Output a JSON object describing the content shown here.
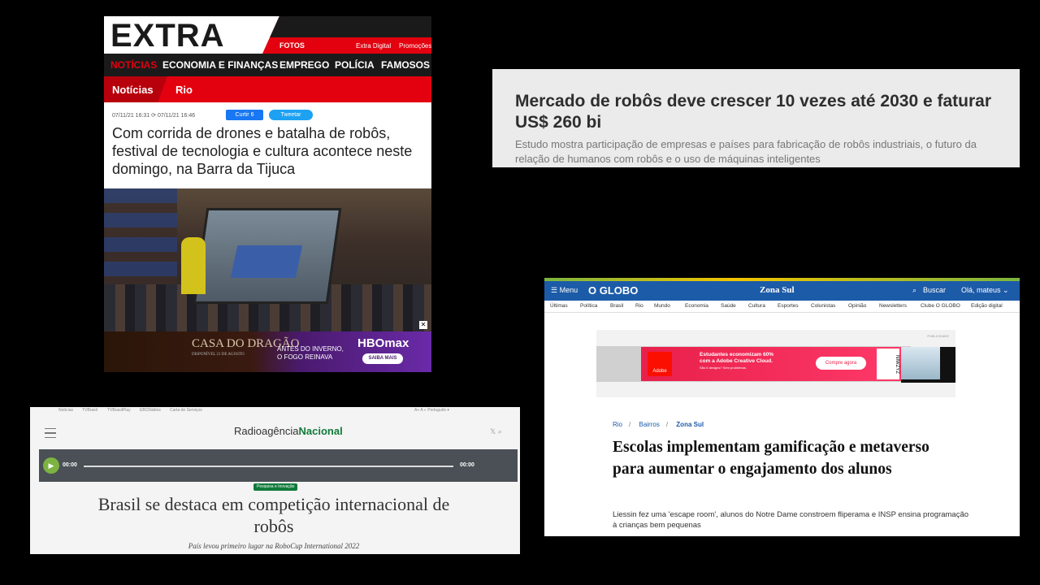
{
  "extra": {
    "logo": "EXTRA",
    "fotos": "FOTOS",
    "extra_digital": "Extra Digital",
    "promocoes": "Promoções",
    "nav": [
      "NOTÍCIAS",
      "ECONOMIA E FINANÇAS",
      "EMPREGO",
      "POLÍCIA",
      "FAMOSOS"
    ],
    "section": "Notícias",
    "subsection": "Rio",
    "meta": "07/11/21 16:31  ⟳ 07/11/21 16:46",
    "curtir": "Curtir 6",
    "tweetar": "Tweetar",
    "headline": "Com corrida de drones e batalha de robôs, festival de tecnologia e cultura acontece neste domingo, na Barra da Tijuca",
    "ad": {
      "casa": "CASA DO DRAGÃO",
      "disponivel": "DISPONÍVEL 21 DE AGOSTO",
      "antes": "ANTES DO INVERNO, O FOGO REINAVA",
      "hbo": "HBOmax",
      "saiba": "SAIBA MAIS",
      "close": "✕"
    }
  },
  "mercado": {
    "headline": "Mercado de robôs deve crescer 10 vezes até 2030 e faturar US$ 260 bi",
    "summary": "Estudo mostra participação de empresas e países para fabricação de robôs industriais, o futuro da relação de humanos com robôs e o uso de máquinas inteligentes"
  },
  "globo": {
    "menu_label": "☰ Menu",
    "logo": "O GLOBO",
    "section": "Zona Sul",
    "buscar": "Buscar",
    "user": "Olá, mateus ⌄",
    "menu": [
      "Últimas",
      "Política",
      "Brasil",
      "Rio",
      "Mundo",
      "Economia",
      "Saúde",
      "Cultura",
      "Esportes",
      "Colunistas",
      "Opinião",
      "Newsletters",
      "Clube O GLOBO",
      "Edição digital"
    ],
    "ad": {
      "tag": "PUBLICIDADE",
      "adobe": "Adobe",
      "line1": "Estudantes economizam 60%",
      "line2": "com a Adobe Creative Cloud.",
      "line3": "São 6 designs? Sem problemas.",
      "button": "Compre agora",
      "side": "NIWZYZ"
    },
    "crumbs": [
      "Rio",
      "Bairros",
      "Zona Sul"
    ],
    "title": "Escolas implementam gamificação e metaverso para aumentar o engajamento dos alunos",
    "lead": "Liessin fez uma 'escape room', alunos do Notre Dame constroem fliperama e INSP ensina programação à crianças bem pequenas"
  },
  "radio": {
    "top": [
      "Notícias",
      "TVBrasil",
      "TVBrasilPlay",
      "EBCRádios",
      "Carta de Serviços"
    ],
    "top_right": "A+  A  ◐   Português ▾",
    "brand_a": "Radioagência",
    "brand_b": "Nacional",
    "icons": "𝕏  ⌕",
    "time_start": "00:00",
    "time_end": "00:00",
    "category": "Pesquisa e Inovação",
    "headline": "Brasil se destaca em competição internacional de robôs",
    "subtitle": "País levou primeiro lugar na RoboCup International 2022"
  }
}
